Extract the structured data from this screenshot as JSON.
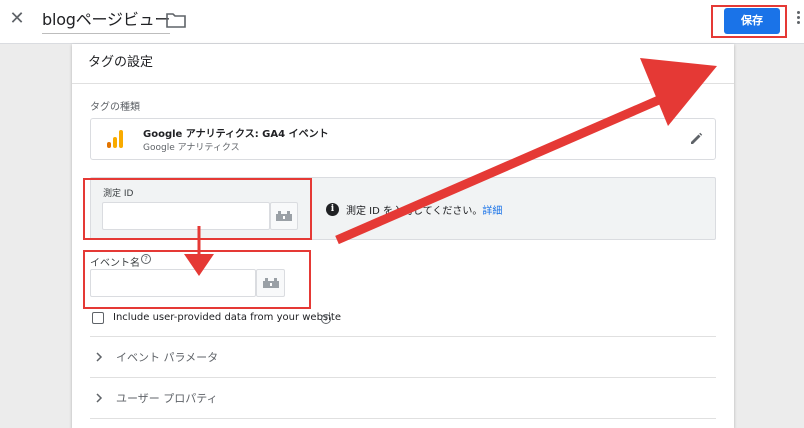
{
  "header": {
    "title": "blogページビュー",
    "save_label": "保存",
    "close_icon": "close-icon",
    "folder_icon": "folder-icon",
    "more_icon": "more-vert-icon"
  },
  "card": {
    "title": "タグの設定",
    "tag_type": {
      "label": "タグの種類",
      "name": "Google アナリティクス: GA4 イベント",
      "subtitle": "Google アナリティクス",
      "icon": "google-analytics-icon",
      "edit_icon": "pencil-icon"
    },
    "measurement_id": {
      "label": "測定 ID",
      "value": "",
      "info_prefix": "測定 ID を入力してください。",
      "info_link": "詳細"
    },
    "event_name": {
      "label": "イベント名",
      "value": ""
    },
    "checkbox": {
      "label": "Include user-provided data from your website",
      "checked": false
    },
    "sections": [
      {
        "label": "イベント パラメータ"
      },
      {
        "label": "ユーザー プロパティ"
      }
    ]
  },
  "colors": {
    "accent": "#1a73e8",
    "annotation": "#e53935",
    "ga_orange": "#f9ab00",
    "ga_dark_orange": "#e37400"
  }
}
